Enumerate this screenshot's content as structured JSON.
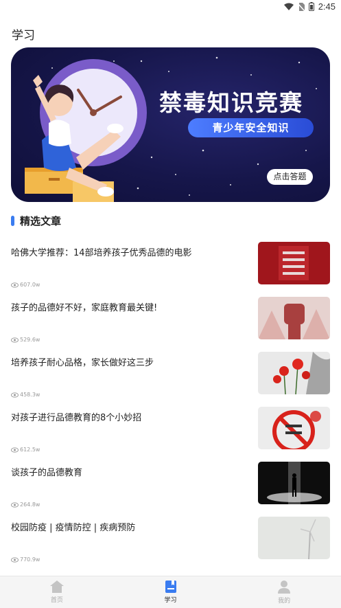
{
  "status_bar": {
    "time": "2:45",
    "battery_level": "1"
  },
  "page": {
    "title": "学习"
  },
  "banner": {
    "title": "禁毒知识竞赛",
    "subtitle": "青少年安全知识",
    "button_label": "点击答题"
  },
  "section": {
    "title": "精选文章"
  },
  "articles": [
    {
      "title": "哈佛大学推荐：14部培养孩子优秀品德的电影",
      "views": "607.0w"
    },
    {
      "title": "孩子的品德好不好，家庭教育最关键!",
      "views": "529.6w"
    },
    {
      "title": "培养孩子耐心品格，家长做好这三步",
      "views": "458.3w"
    },
    {
      "title": "对孩子进行品德教育的8个小妙招",
      "views": "612.5w"
    },
    {
      "title": "谈孩子的品德教育",
      "views": "264.8w"
    },
    {
      "title": "校园防疫 | 疫情防控 | 疾病预防",
      "views": "770.9w"
    }
  ],
  "tabbar": {
    "items": [
      {
        "label": "首页",
        "icon": "home-icon",
        "active": false
      },
      {
        "label": "学习",
        "icon": "book-icon",
        "active": true
      },
      {
        "label": "我的",
        "icon": "user-icon",
        "active": false
      }
    ]
  },
  "colors": {
    "accent": "#3a7cf0",
    "banner_bg": "#16164a",
    "tabbar_bg": "#f5f5f5"
  }
}
